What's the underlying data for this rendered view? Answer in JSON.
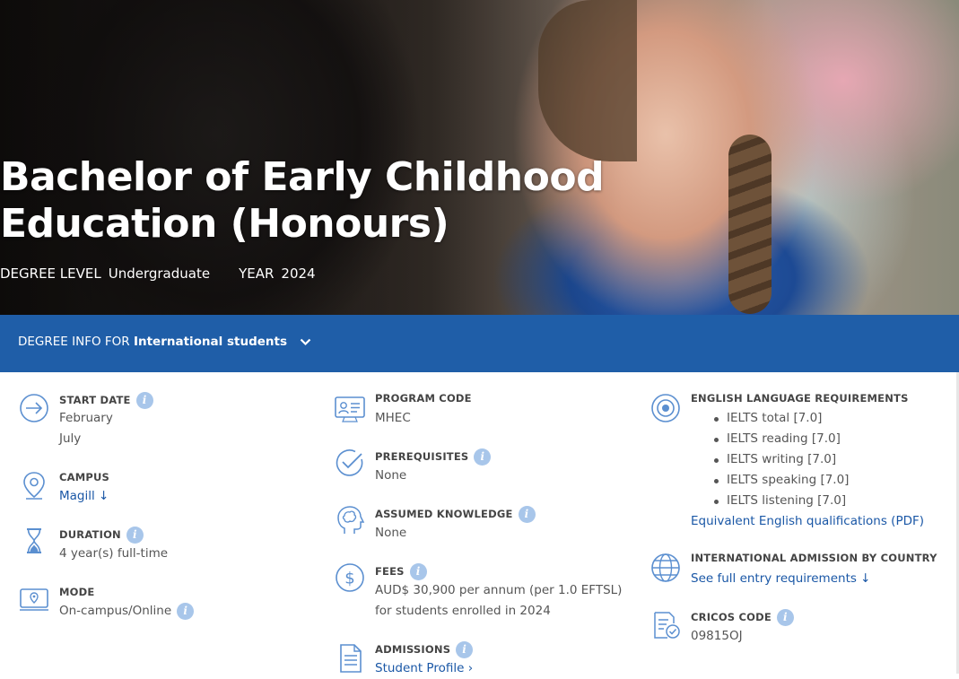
{
  "hero": {
    "title_line1": "Bachelor of Early Childhood",
    "title_line2": "Education (Honours)",
    "degree_level_label": "DEGREE LEVEL",
    "degree_level_value": "Undergraduate",
    "year_label": "YEAR",
    "year_value": "2024"
  },
  "info_bar": {
    "prefix": "DEGREE INFO FOR",
    "audience": "International students"
  },
  "col1": {
    "start_date": {
      "title": "START DATE",
      "values": [
        "February",
        "July"
      ]
    },
    "campus": {
      "title": "CAMPUS",
      "value": "Magill ↓"
    },
    "duration": {
      "title": "DURATION",
      "value": "4 year(s) full-time"
    },
    "mode": {
      "title": "MODE",
      "value": "On-campus/Online"
    }
  },
  "col2": {
    "program_code": {
      "title": "PROGRAM CODE",
      "value": "MHEC"
    },
    "prerequisites": {
      "title": "PREREQUISITES",
      "value": "None"
    },
    "assumed_knowledge": {
      "title": "ASSUMED KNOWLEDGE",
      "value": "None"
    },
    "fees": {
      "title": "FEES",
      "line1": "AUD$ 30,900 per annum (per 1.0 EFTSL)",
      "line2": "for students enrolled in 2024"
    },
    "admissions": {
      "title": "ADMISSIONS",
      "link": "Student Profile ›"
    }
  },
  "col3": {
    "english": {
      "title": "ENGLISH LANGUAGE REQUIREMENTS",
      "items": [
        "IELTS total [7.0]",
        "IELTS reading [7.0]",
        "IELTS writing [7.0]",
        "IELTS speaking [7.0]",
        "IELTS listening [7.0]"
      ],
      "link": "Equivalent English qualifications (PDF)"
    },
    "admission_by_country": {
      "title": "INTERNATIONAL ADMISSION BY COUNTRY",
      "link": "See full entry requirements ↓"
    },
    "cricos": {
      "title": "CRICOS CODE",
      "value": "09815OJ"
    }
  },
  "colors": {
    "brand_blue": "#1f5ea8",
    "link": "#1a57a6",
    "icon_blue": "#5b8fd0",
    "info_badge": "#a8c6ea"
  }
}
